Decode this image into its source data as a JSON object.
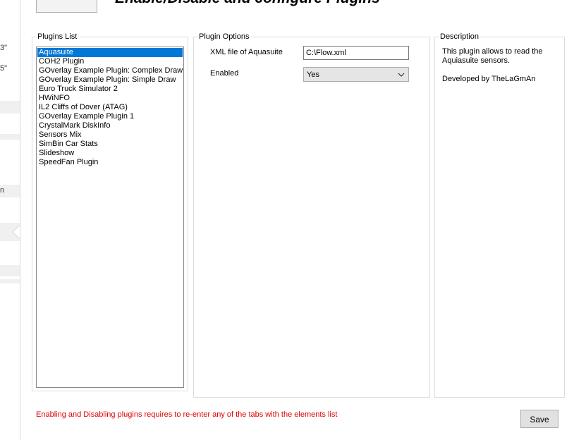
{
  "header": {
    "title": "Enable/Disable and configure Plugins",
    "top_button_label": ""
  },
  "left_strip": {
    "fragment_1": "3\"",
    "fragment_2": "5\"",
    "fragment_3": "n"
  },
  "plugins_list": {
    "label": "Plugins List",
    "items": [
      "Aquasuite",
      "COH2 Plugin",
      "GOverlay Example Plugin: Complex Draw",
      "GOverlay Example Plugin: Simple Draw",
      "Euro Truck Simulator 2",
      "HWiNFO",
      "IL2 Cliffs of Dover (ATAG)",
      "GOverlay Example Plugin 1",
      "CrystalMark DiskInfo",
      "Sensors Mix",
      "SimBin Car Stats",
      "Slideshow",
      "SpeedFan Plugin"
    ],
    "selected_index": 0
  },
  "plugin_options": {
    "label": "Plugin Options",
    "xml_label": "XML file of Aquasuite",
    "xml_value": "C:\\Flow.xml",
    "enabled_label": "Enabled",
    "enabled_value": "Yes"
  },
  "description": {
    "label": "Description",
    "text": "This plugin allows to read the Aquiasuite sensors.",
    "author": "Developed by TheLaGmAn"
  },
  "footer": {
    "warning": "Enabling and Disabling plugins requires to re-enter any of the tabs with the elements list",
    "save_label": "Save"
  },
  "colors": {
    "selection": "#0078d7",
    "warning": "#e00000"
  }
}
